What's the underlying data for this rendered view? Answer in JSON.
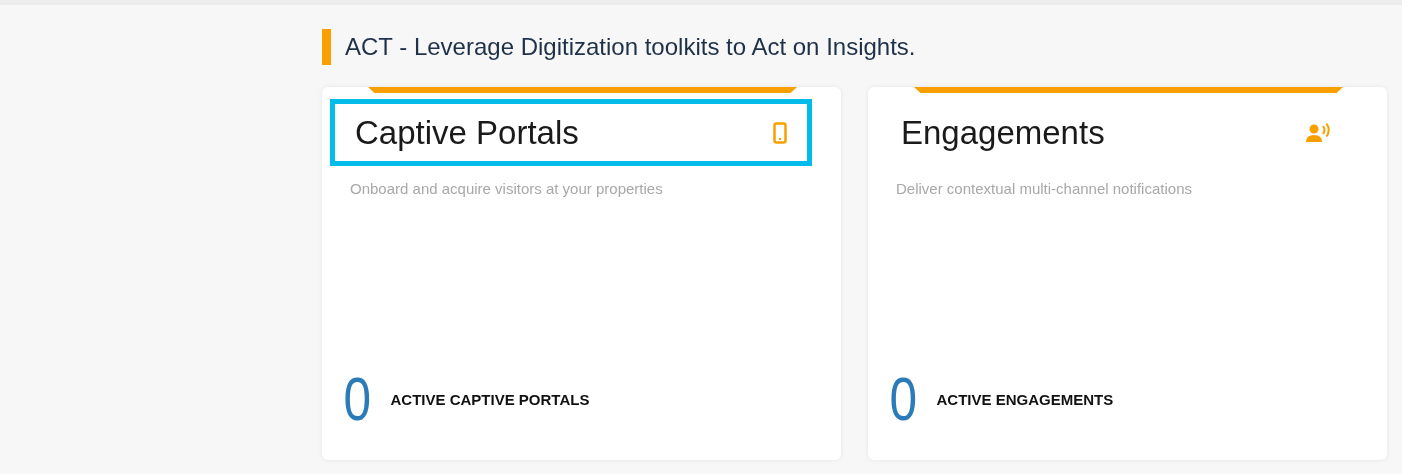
{
  "section": {
    "title": "ACT - Leverage Digitization toolkits to Act on Insights."
  },
  "cards": [
    {
      "title": "Captive Portals",
      "kind": "portal",
      "highlighted": true,
      "description": "Onboard and acquire visitors at your properties",
      "count": "0",
      "count_label": "ACTIVE CAPTIVE PORTALS"
    },
    {
      "title": "Engagements",
      "kind": "engagement",
      "highlighted": false,
      "description": "Deliver contextual multi-channel notifications",
      "count": "0",
      "count_label": "ACTIVE ENGAGEMENTS"
    }
  ]
}
